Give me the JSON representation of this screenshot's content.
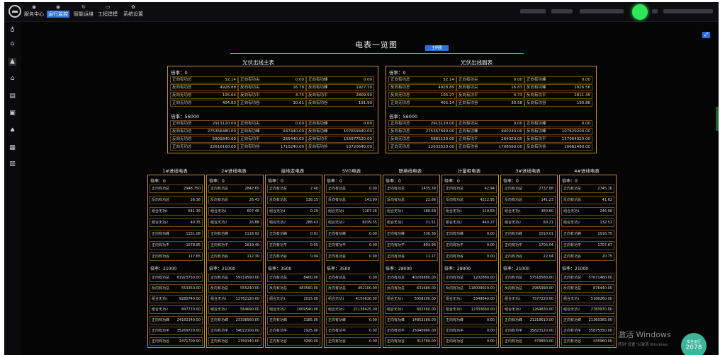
{
  "nav": [
    {
      "label": "服务中心",
      "icon": "home-icon"
    },
    {
      "label": "运行监控",
      "icon": "monitor-icon",
      "active": true
    },
    {
      "label": "智能运维",
      "icon": "refresh-icon"
    },
    {
      "label": "工程建模",
      "icon": "box-icon"
    },
    {
      "label": "系统设置",
      "icon": "gear-icon"
    }
  ],
  "sidebar_icons": [
    "location-icon",
    "home-icon",
    "chart-icon",
    "home-icon",
    "document-icon",
    "report-icon",
    "tree-icon",
    "table-icon",
    "list-icon"
  ],
  "page": {
    "title": "电表一览图",
    "button": "主网图",
    "expand_icon": "⤢"
  },
  "top_panels": [
    {
      "title": "光伏出线主表",
      "g1": {
        "rate": "倍率：0",
        "rows": [
          [
            "正向有功总",
            "52.14",
            "正向有功尖",
            "0.00",
            "正向有功峰",
            "0.00"
          ],
          [
            "反向有功总",
            "4928.88",
            "反向有功尖",
            "16.78",
            "反向有功峰",
            "1927.10"
          ],
          [
            "反向无功总",
            "105.64",
            "反向有功平",
            "4.75",
            "反向有功平",
            "2809.90"
          ],
          [
            "正向无功总",
            "404.83",
            "正向有功谷",
            "30.61",
            "反向有功谷",
            "191.90"
          ]
        ]
      },
      "g2": {
        "rate": "倍率：56000",
        "rows": [
          [
            "正向有功总",
            "2913120.00",
            "正向有功尖",
            "0.00",
            "正向有功峰",
            "0.00"
          ],
          [
            "反向有功总",
            "275356480.00",
            "正向有功峰",
            "937440.00",
            "反向有功峰",
            "107659440.00"
          ],
          [
            "反向无功总",
            "5901840.00",
            "正向有功平",
            "265440.00",
            "反向有功平",
            "156977520.00"
          ],
          [
            "正向无功总",
            "22616160.00",
            "正向有功谷",
            "1710240.00",
            "反向有功谷",
            "10720640.00"
          ]
        ]
      }
    },
    {
      "title": "光伏出线副表",
      "g1": {
        "rate": "倍率：0",
        "rows": [
          [
            "正向有功总",
            "52.14",
            "正向有功尖",
            "0.00",
            "正向有功峰",
            "0.00"
          ],
          [
            "反向有功总",
            "4928.89",
            "反向有功尖",
            "16.83",
            "反向有功峰",
            "1926.56"
          ],
          [
            "反向无功总",
            "105.27",
            "反向有功平",
            "4.73",
            "反向有功平",
            "2811.45"
          ],
          [
            "正向无功总",
            "405.14",
            "正向有功谷",
            "30.58",
            "反向有功谷",
            "190.86"
          ]
        ]
      },
      "g2": {
        "rate": "倍率：56000",
        "rows": [
          [
            "正向有功总",
            "2913120.00",
            "正向有功尖",
            "0.00",
            "正向有功峰",
            "0.00"
          ],
          [
            "反向有功总",
            "275357640.00",
            "正向有功峰",
            "940240.00",
            "反向有功峰",
            "107629200.00"
          ],
          [
            "反向无功总",
            "5881120.00",
            "正向有功平",
            "264320.00",
            "反向有功平",
            "157064320.00"
          ],
          [
            "正向无功总",
            "22633520.00",
            "正向有功谷",
            "1708560.00",
            "反向有功谷",
            "10662480.00"
          ]
        ]
      }
    }
  ],
  "meters": [
    {
      "title": "1#进线电表",
      "rate1": "倍率：0",
      "g1": [
        [
          "正向有功总",
          "2948.750"
        ],
        [
          "反向有功总",
          "26.36"
        ],
        [
          "组合无功1",
          "641.36"
        ],
        [
          "组合无功2",
          "40.35"
        ],
        [
          "正向有功峰",
          "1151.08"
        ],
        [
          "正向有功平",
          "1678.85"
        ],
        [
          "正向有功谷",
          "117.65"
        ]
      ],
      "rate2": "倍率：21000",
      "g2": [
        [
          "正向有功总",
          "61923750.00"
        ],
        [
          "反向有功总",
          "553350.00"
        ],
        [
          "组合无功1",
          "9280740.00"
        ],
        [
          "组合无功2",
          "847770.00"
        ],
        [
          "正向有功峰",
          "24182340.00"
        ],
        [
          "正向有功平",
          "35269720.00"
        ],
        [
          "正向有功谷",
          "2471700.00"
        ]
      ]
    },
    {
      "title": "2#进线电表",
      "rate1": "倍率：0",
      "g1": [
        [
          "正向有功总",
          "2842.65"
        ],
        [
          "反向有功总",
          "26.43"
        ],
        [
          "组合无功1",
          "607.48"
        ],
        [
          "组合无功2",
          "26.88"
        ],
        [
          "正向有功峰",
          "1118.92"
        ],
        [
          "正向有功平",
          "1619.40"
        ],
        [
          "正向有功谷",
          "112.30"
        ]
      ],
      "rate2": "倍率：21000",
      "g2": [
        [
          "正向有功总",
          "59719590.00"
        ],
        [
          "反向有功总",
          "555240.00"
        ],
        [
          "组合无功1",
          "12762120.00"
        ],
        [
          "组合无功2",
          "564690.00"
        ],
        [
          "正向有功峰",
          "23338560.00"
        ],
        [
          "正向有功平",
          "34022100.00"
        ],
        [
          "正向有功谷",
          "2359140.00"
        ]
      ]
    },
    {
      "title": "接地变电表",
      "rate1": "倍率：0",
      "g1": [
        [
          "正向有功总",
          "2.40"
        ],
        [
          "反向有功总",
          "138.15"
        ],
        [
          "组合无功1",
          "0.29"
        ],
        [
          "组合无功2",
          "288.43"
        ],
        [
          "正向有功峰",
          "0.91"
        ],
        [
          "正向有功平",
          "0.55"
        ],
        [
          "正向有功谷",
          "0.94"
        ]
      ],
      "rate2": "倍率：3500",
      "g2": [
        [
          "正向有功总",
          "8400.00"
        ],
        [
          "反向有功总",
          "483560.00"
        ],
        [
          "组合无功1",
          "1015.00"
        ],
        [
          "组合无功2",
          "1009540.00"
        ],
        [
          "正向有功峰",
          "3185.00"
        ],
        [
          "正向有功平",
          "1925.00"
        ],
        [
          "正向有功谷",
          "3290.00"
        ]
      ]
    },
    {
      "title": "SVG电表",
      "rate1": "倍率：0",
      "g1": [
        [
          "正向有功总",
          "0.00"
        ],
        [
          "反向有功总",
          "143.99"
        ],
        [
          "组合无功1",
          "1187.26"
        ],
        [
          "组合无功2",
          "6039.35"
        ],
        [
          "正向有功峰",
          "0.00"
        ],
        [
          "正向有功平",
          "0.00"
        ],
        [
          "正向有功谷",
          "0.00"
        ]
      ],
      "rate2": "倍率：3500",
      "g2": [
        [
          "正向有功总",
          "0.00"
        ],
        [
          "反向有功总",
          "492100.00"
        ],
        [
          "组合无功1",
          "4155630.00"
        ],
        [
          "组合无功2",
          "21138425.00"
        ],
        [
          "正向有功峰",
          "0.00"
        ],
        [
          "正向有功平",
          "0.00"
        ],
        [
          "正向有功谷",
          "0.00"
        ]
      ]
    },
    {
      "title": "联络线电表",
      "rate1": "倍率：0",
      "g1": [
        [
          "正向有功总",
          "1435.39"
        ],
        [
          "反向有功总",
          "22.66"
        ],
        [
          "组合无功1",
          "180.58"
        ],
        [
          "组合无功2",
          "21.51"
        ],
        [
          "正向有功峰",
          "530.36"
        ],
        [
          "正向有功平",
          "893.96"
        ],
        [
          "正向有功谷",
          "11.17"
        ]
      ],
      "rate2": "倍率：28000",
      "g2": [
        [
          "正向有功总",
          "40206880.00"
        ],
        [
          "反向有功总",
          "631680.00"
        ],
        [
          "组合无功1",
          "5058200.00"
        ],
        [
          "组合无功2",
          "602560.00"
        ],
        [
          "正向有功峰",
          "14852160.00"
        ],
        [
          "正向有功平",
          "25040960.00"
        ],
        [
          "正向有功谷",
          "312760.00"
        ]
      ]
    },
    {
      "title": "计量柜电表",
      "rate1": "倍率：0",
      "g1": [
        [
          "正向有功总",
          "42.94"
        ],
        [
          "反向有功总",
          "4212.95"
        ],
        [
          "组合无功1",
          "119.58"
        ],
        [
          "组合无功2",
          "440.27"
        ],
        [
          "正向有功峰",
          "0.00"
        ],
        [
          "正向有功平",
          "0.00"
        ],
        [
          "正向有功谷",
          "0.00"
        ]
      ],
      "rate2": "倍率：28000",
      "g2": [
        [
          "正向有功总",
          "1202880.00"
        ],
        [
          "反向有功总",
          "118009920.00"
        ],
        [
          "组合无功1",
          "3349640.00"
        ],
        [
          "组合无功2",
          "12333680.00"
        ],
        [
          "正向有功峰",
          "0.00"
        ],
        [
          "正向有功平",
          "0.00"
        ],
        [
          "正向有功谷",
          "0.00"
        ]
      ]
    },
    {
      "title": "3#进线电表",
      "rate1": "倍率：0",
      "g1": [
        [
          "正向有功总",
          "2737.08"
        ],
        [
          "反向有功总",
          "141.23"
        ],
        [
          "组合无功1",
          "360.60"
        ],
        [
          "组合无功2",
          "60.21"
        ],
        [
          "正向有功峰",
          "1010.01"
        ],
        [
          "正向有功平",
          "1705.04"
        ],
        [
          "正向有功谷",
          "22.04"
        ]
      ],
      "rate2": "倍率：21000",
      "g2": [
        [
          "正向有功总",
          "57518580.00"
        ],
        [
          "反向有功总",
          "2965990.00"
        ],
        [
          "组合无功1",
          "7577220.00"
        ],
        [
          "组合无功2",
          "1264830.00"
        ],
        [
          "正向有功峰",
          "21218610.00"
        ],
        [
          "正向有功平",
          "35823120.00"
        ],
        [
          "正向有功谷",
          "479850.00"
        ]
      ]
    },
    {
      "title": "4#进线电表",
      "rate1": "倍率：0",
      "g1": [
        [
          "正向有功总",
          "2745.16"
        ],
        [
          "反向有功总",
          "41.62"
        ],
        [
          "组合无功1",
          "246.96"
        ],
        [
          "组合无功2",
          "132.52"
        ],
        [
          "正向有功峰",
          "1016.75"
        ],
        [
          "正向有功平",
          "1707.67"
        ],
        [
          "正向有功谷",
          "20.75"
        ]
      ],
      "rate2": "倍率：21000",
      "g2": [
        [
          "正向有功总",
          "57671460.00"
        ],
        [
          "反向有功总",
          "876440.00"
        ],
        [
          "组合无功1",
          "5188260.00"
        ],
        [
          "组合无功2",
          "2783970.00"
        ],
        [
          "正向有功峰",
          "21360365.00"
        ],
        [
          "正向有功平",
          "35875350.00"
        ],
        [
          "正向有功谷",
          "435960.00"
        ]
      ]
    }
  ],
  "watermark": {
    "line1": "激活 Windows",
    "line2": "转到\"设置\"以激活 Windows"
  },
  "badge": {
    "label": "安全运行",
    "value": "2078"
  },
  "colors": {
    "accent": "#2f6fe0",
    "panel_border": "#c98a2f",
    "online": "#2ee85a",
    "badge": "#3cb59b"
  }
}
